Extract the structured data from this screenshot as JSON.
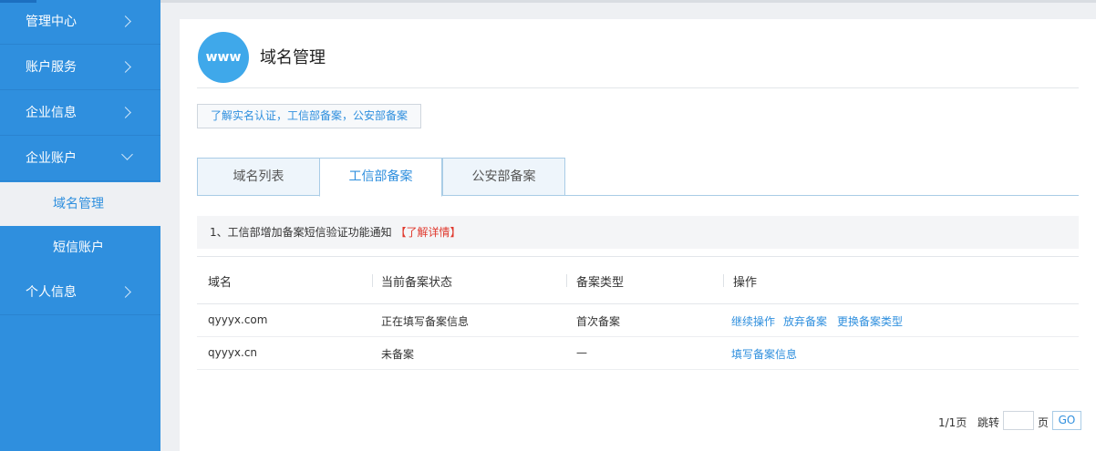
{
  "sidebar": {
    "items": [
      {
        "label": "管理中心"
      },
      {
        "label": "账户服务"
      },
      {
        "label": "企业信息"
      },
      {
        "label": "企业账户"
      },
      {
        "label": "个人信息"
      }
    ],
    "sub_items": [
      {
        "label": "域名管理",
        "active": true
      },
      {
        "label": "短信账户",
        "active": false
      }
    ]
  },
  "header": {
    "logo_text": "www",
    "title": "域名管理"
  },
  "info_link": "了解实名认证，工信部备案，公安部备案",
  "tabs": [
    {
      "label": "域名列表",
      "active": false
    },
    {
      "label": "工信部备案",
      "active": true
    },
    {
      "label": "公安部备案",
      "active": false
    }
  ],
  "notice": {
    "text": "1、工信部增加备案短信验证功能通知",
    "link": "【了解详情】"
  },
  "table": {
    "columns": [
      "域名",
      "当前备案状态",
      "备案类型",
      "操作"
    ],
    "rows": [
      {
        "domain": "qyyyx.com",
        "status": "正在填写备案信息",
        "type": "首次备案",
        "actions": [
          "继续操作",
          "放弃备案",
          "更换备案类型"
        ]
      },
      {
        "domain": "qyyyx.cn",
        "status": "未备案",
        "type": "—",
        "actions": [
          "填写备案信息"
        ]
      }
    ]
  },
  "pager": {
    "page_info": "1/1页",
    "jump_label": "跳转",
    "page_unit": "页",
    "go_label": "GO"
  },
  "colors": {
    "sidebar_bg": "#2f8fde",
    "accent": "#2f8fde",
    "notice_link": "#e0392e"
  }
}
